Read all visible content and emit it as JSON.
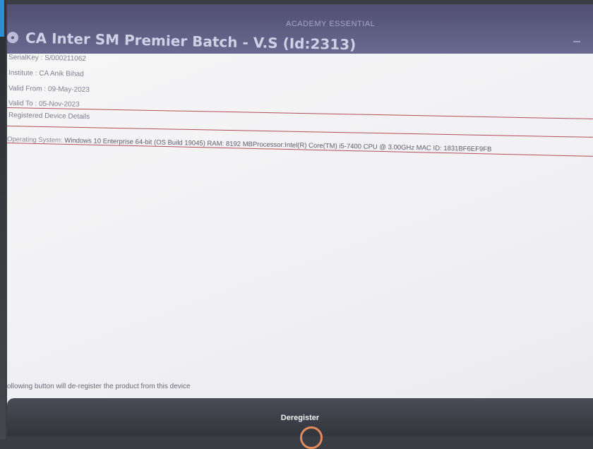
{
  "window": {
    "title": "ACADEMY ESSENTIAL"
  },
  "product": {
    "icon": "product-badge-icon",
    "title": "CA Inter SM Premier Batch - V.S (Id:2313)"
  },
  "details": {
    "serial_key": "SerialKey : S/000211062",
    "institute": "Institute : CA Anik Bihad",
    "valid_from": "Valid From : 09-May-2023",
    "valid_to": "Valid To : 05-Nov-2023"
  },
  "registered_device": {
    "label": "Registered Device Details",
    "os_label": "Operating System:",
    "os_value": "Windows 10 Enterprise 64-bit (OS Build 19045) RAM: 8192 MBProcessor:Intel(R) Core(TM) i5-7400 CPU @ 3.00GHz MAC ID: 1831BF6EF9FB"
  },
  "footer": {
    "hint": "ollowing button will de-register the product from this device",
    "deregister_label": "Deregister"
  },
  "colors": {
    "header": "#5d5c82",
    "divider": "#b24d5a",
    "button": "#3d3f48"
  }
}
